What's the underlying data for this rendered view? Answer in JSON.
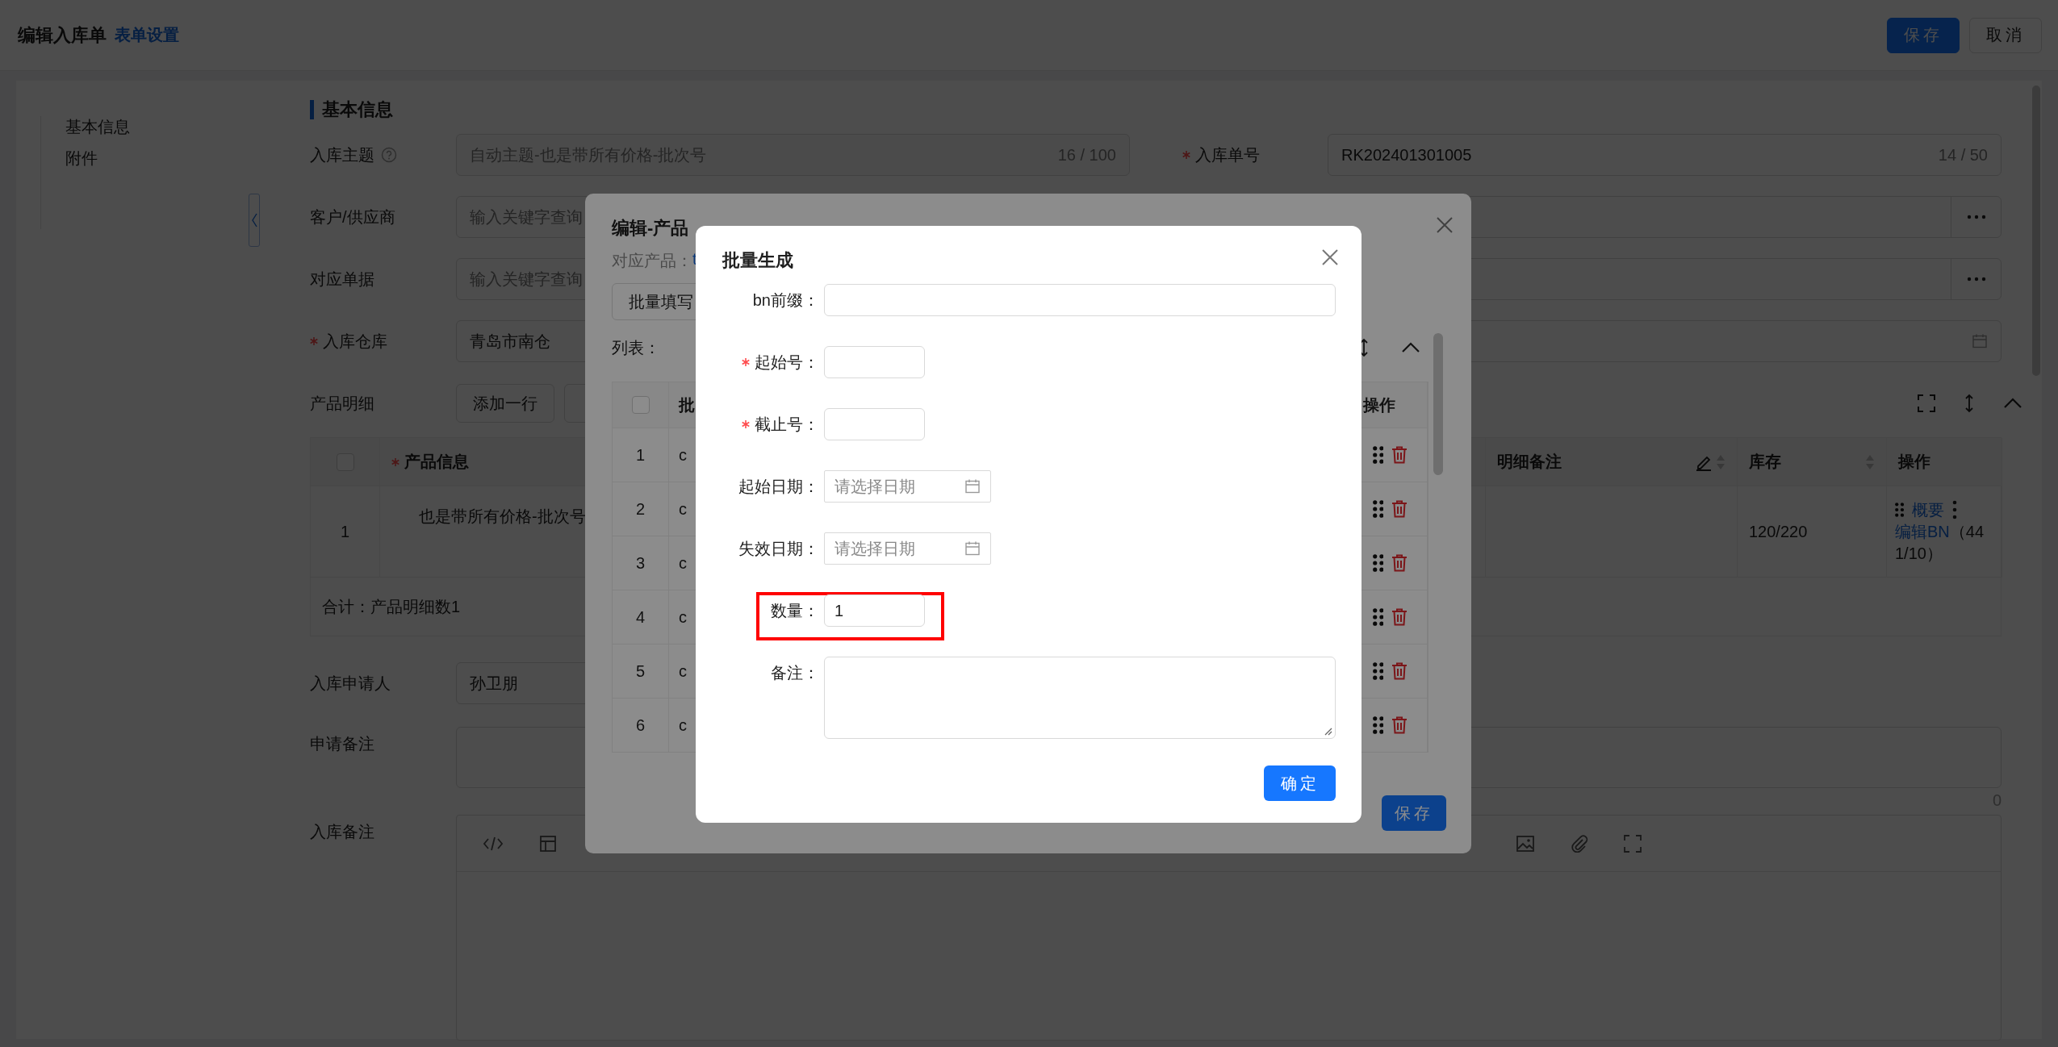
{
  "header": {
    "title": "编辑入库单",
    "link": "表单设置",
    "buttons": [
      {
        "label": "保存",
        "kind": "primary"
      },
      {
        "label": "取消",
        "kind": "default"
      }
    ]
  },
  "sidebar": {
    "items": [
      {
        "label": "基本信息"
      },
      {
        "label": "附件"
      }
    ]
  },
  "section_title": "基本信息",
  "form_rows": [
    {
      "label": "入库主题",
      "required": false,
      "help": true,
      "field": {
        "kind": "text",
        "value": "自动主题-也是带所有价格-批次号",
        "count": "16 / 100",
        "disabled": true
      },
      "right": {
        "label": "入库单号",
        "required": true,
        "field": {
          "kind": "text",
          "value": "RK202401301005",
          "count": "14 / 50",
          "disabled": false
        }
      }
    },
    {
      "label": "客户/供应商",
      "required": false,
      "help": false,
      "field": {
        "kind": "lookup",
        "placeholder": "输入关键字查询"
      }
    },
    {
      "label": "对应单据",
      "required": false,
      "help": false,
      "field": {
        "kind": "lookup",
        "placeholder": "输入关键字查询"
      }
    },
    {
      "label": "入库仓库",
      "required": true,
      "help": false,
      "field": {
        "kind": "select",
        "value": "青岛市南仓"
      },
      "right": {
        "field": {
          "kind": "date"
        }
      }
    }
  ],
  "products": {
    "label": "产品明细",
    "buttons": [
      {
        "label": "添加一行"
      }
    ],
    "all_checked": false,
    "columns": [
      {
        "label": "产品信息",
        "required": true,
        "editable": false,
        "sortable": false
      },
      {
        "label": "明细备注",
        "required": false,
        "editable": true,
        "sortable": true
      },
      {
        "label": "库存",
        "required": false,
        "editable": false,
        "sortable": true
      },
      {
        "label": "操作",
        "required": false,
        "editable": false,
        "sortable": false
      }
    ],
    "rows": [
      {
        "index": "1",
        "product": "也是带所有价格-批次号",
        "stock": "120/220",
        "summary_link": "概要",
        "bn_link": "编辑BN",
        "bn_count": "（441/10）"
      }
    ],
    "footer": "合计：产品明细数1"
  },
  "applicant": {
    "label": "入库申请人",
    "value": "孙卫朋"
  },
  "apply_note": {
    "label": "申请备注",
    "count": "0"
  },
  "inbound_note": {
    "label": "入库备注"
  },
  "bn_dialog": {
    "title": "编辑-产品",
    "all_checked": false,
    "product_label": "对应产品：",
    "product_link": "t",
    "fill_button": "批量填写",
    "list_label": "列表：",
    "columns": [
      {
        "label": "批"
      },
      {
        "label": "操作"
      }
    ],
    "rows": [
      {
        "index": "1",
        "code": "c"
      },
      {
        "index": "2",
        "code": "c"
      },
      {
        "index": "3",
        "code": "c"
      },
      {
        "index": "4",
        "code": "c"
      },
      {
        "index": "5",
        "code": "c"
      },
      {
        "index": "6",
        "code": "c"
      }
    ],
    "save_button": "保存"
  },
  "batch_dialog": {
    "title": "批量生成",
    "fields": [
      {
        "kind": "text",
        "label": "bn前缀：",
        "required": false,
        "highlighted": false
      },
      {
        "kind": "number",
        "label": "起始号：",
        "required": true,
        "highlighted": false
      },
      {
        "kind": "number",
        "label": "截止号：",
        "required": true,
        "highlighted": false
      },
      {
        "kind": "date",
        "label": "起始日期：",
        "required": false,
        "highlighted": false,
        "placeholder": "请选择日期"
      },
      {
        "kind": "date",
        "label": "失效日期：",
        "required": false,
        "highlighted": false,
        "placeholder": "请选择日期"
      },
      {
        "kind": "number",
        "label": "数量：",
        "required": false,
        "highlighted": true,
        "value": "1"
      },
      {
        "kind": "textarea",
        "label": "备注：",
        "required": false,
        "highlighted": false
      }
    ],
    "confirm_button": "确定"
  }
}
